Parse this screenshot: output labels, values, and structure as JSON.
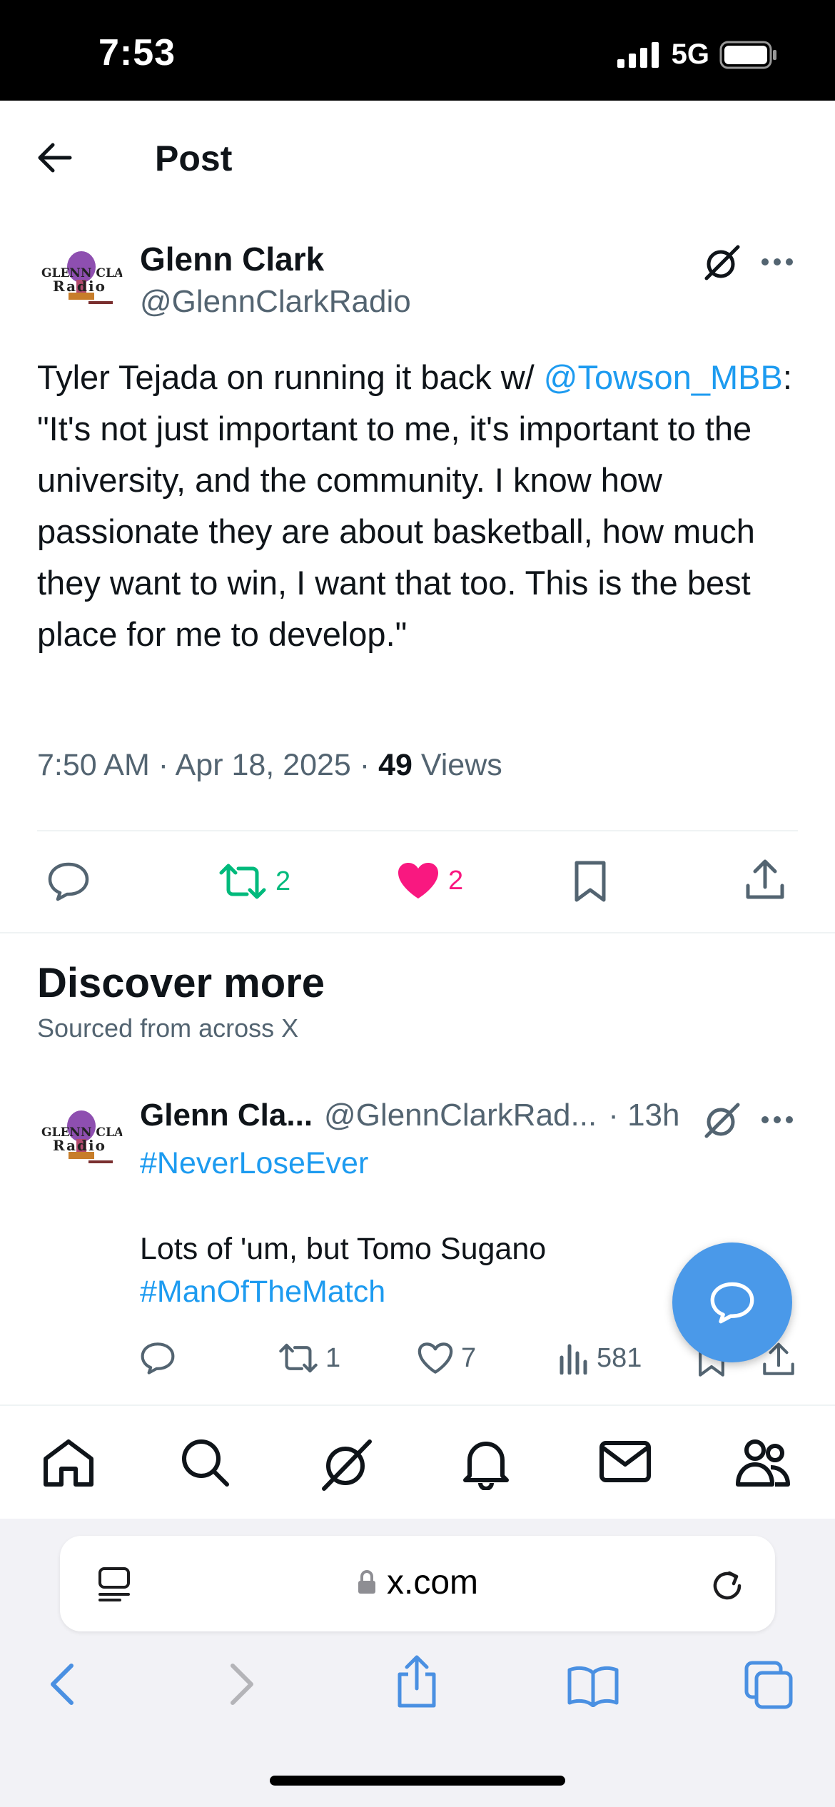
{
  "status_bar": {
    "time": "7:53",
    "network": "5G"
  },
  "header": {
    "title": "Post"
  },
  "post": {
    "author_name": "Glenn Clark",
    "author_handle": "@GlennClarkRadio",
    "text_intro": "Tyler Tejada on running it back w/ ",
    "mention": "@Towson_MBB",
    "text_rest": ": \"It's not just important to me, it's important to the university, and the community. I know how passionate they are about basketball, how much they want to win, I want that too. This is the best place for me to develop.\"",
    "timestamp": "7:50 AM · Apr 18, 2025 · ",
    "views_count": "49",
    "views_label": " Views",
    "retweets": "2",
    "likes": "2"
  },
  "discover": {
    "title": "Discover more",
    "subtitle": "Sourced from across X"
  },
  "tweet2": {
    "author_name": "Glenn Cla...",
    "author_handle": "@GlennClarkRad...",
    "time": "· 13h",
    "hashtag1": "#NeverLoseEver",
    "text": "Lots of 'um, but Tomo Sugano",
    "hashtag2": "#ManOfTheMatch",
    "retweets": "1",
    "likes": "7",
    "views": "581"
  },
  "browser": {
    "url": "x.com"
  },
  "colors": {
    "accent": "#1d9bf0",
    "like": "#f91880",
    "retweet": "#00ba7c",
    "fab": "#4a99e9"
  },
  "icons": [
    "back-arrow-icon",
    "grok-icon",
    "more-icon",
    "reply-icon",
    "retweet-icon",
    "heart-icon",
    "bookmark-icon",
    "share-icon",
    "views-icon",
    "home-icon",
    "search-icon",
    "bell-icon",
    "mail-icon",
    "communities-icon",
    "reader-icon",
    "lock-icon",
    "reload-icon",
    "chevron-left-icon",
    "chevron-right-icon",
    "book-icon",
    "tabs-icon"
  ]
}
